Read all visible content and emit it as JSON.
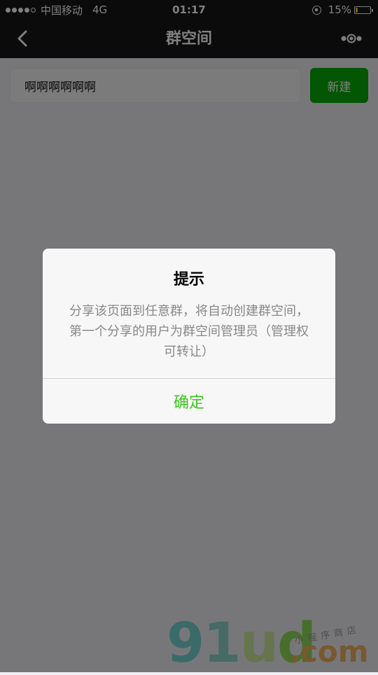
{
  "status_bar": {
    "carrier": "中国移动",
    "network": "4G",
    "time": "01:17",
    "battery": "15%",
    "battery_level": 0.15,
    "battery_color": "#f5c400"
  },
  "nav": {
    "title": "群空间",
    "back_icon": "chevron-left-icon",
    "more_icon": "more-dots-icon"
  },
  "form": {
    "input_value": "啊啊啊啊啊啊",
    "create_label": "新建",
    "accent_color": "#07ad07"
  },
  "dialog": {
    "title": "提示",
    "message": "分享该页面到任意群，将自动创建群空间，第一个分享的用户为群空间管理员（管理权可转让）",
    "confirm_label": "确定",
    "confirm_color": "#3cc51f"
  },
  "watermark": {
    "main": "91ud",
    "com": ".com",
    "tagline": "小程序商店"
  }
}
